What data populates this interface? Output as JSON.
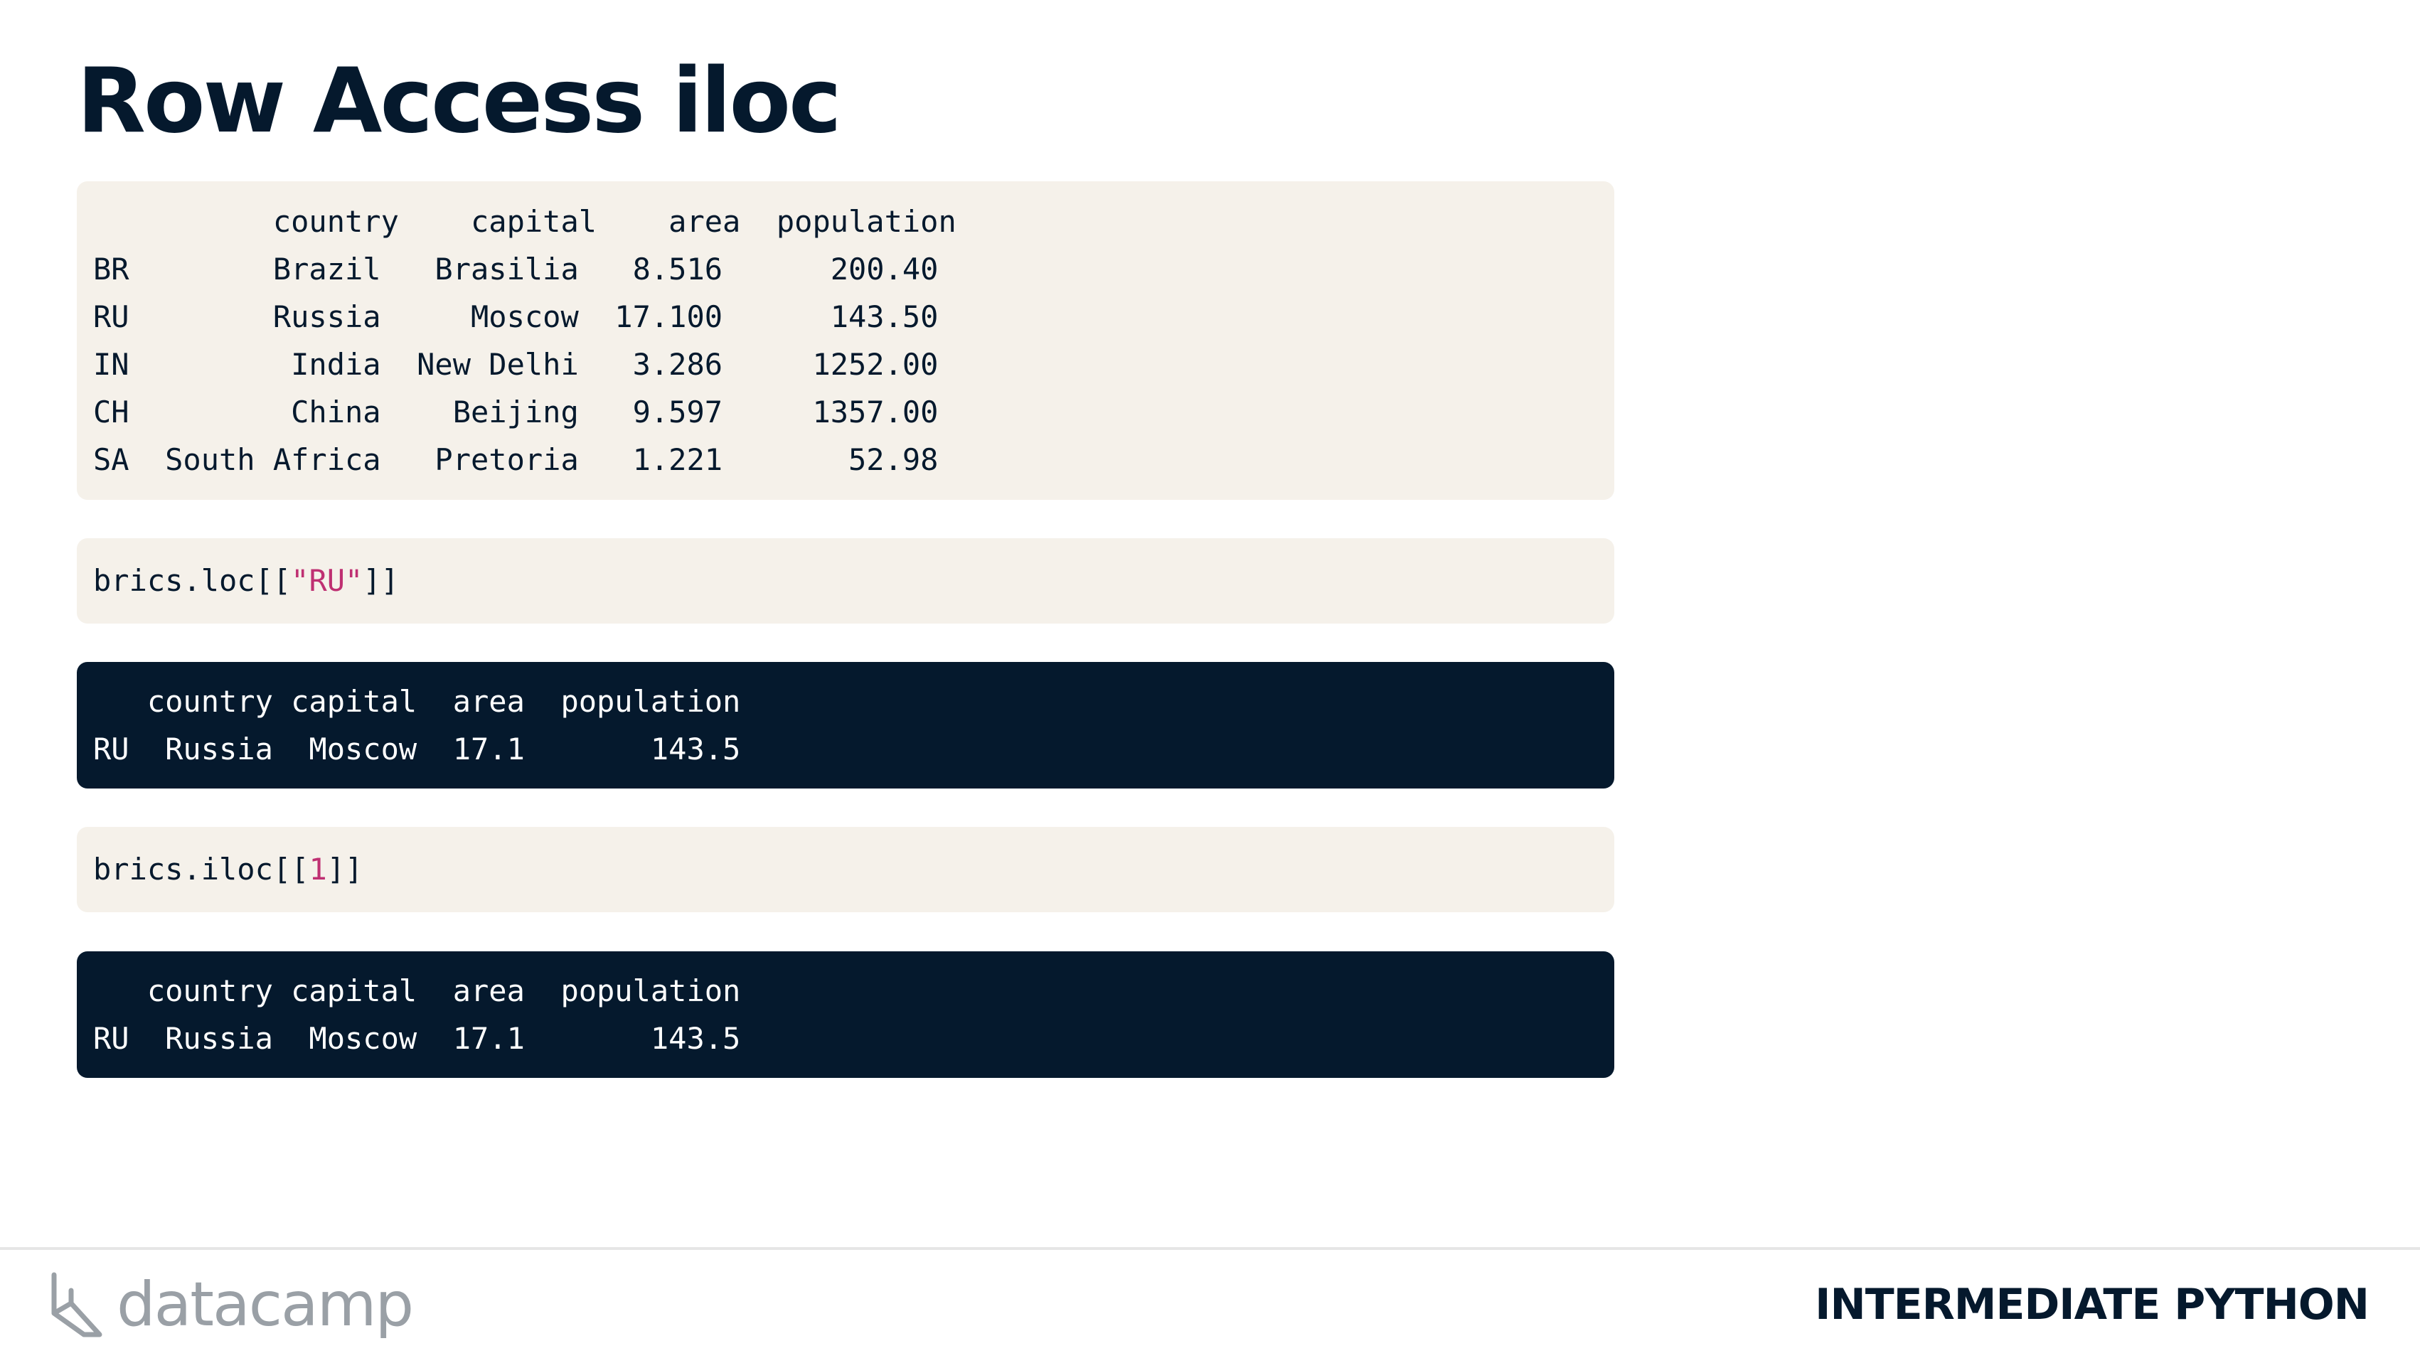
{
  "slide": {
    "title": "Row Access iloc"
  },
  "dataframe_block": {
    "lines": [
      "          country    capital    area  population",
      "BR        Brazil   Brasilia   8.516      200.40",
      "RU        Russia     Moscow  17.100      143.50",
      "IN         India  New Delhi   3.286     1252.00",
      "CH         China    Beijing   9.597     1357.00",
      "SA  South Africa   Pretoria   1.221       52.98"
    ]
  },
  "code_loc": {
    "prefix": "brics.loc[[",
    "arg": "\"RU\"",
    "suffix": "]]"
  },
  "output_loc": {
    "lines": [
      "   country capital  area  population",
      "RU  Russia  Moscow  17.1       143.5"
    ]
  },
  "code_iloc": {
    "prefix": "brics.iloc[[",
    "arg": "1",
    "suffix": "]]"
  },
  "output_iloc": {
    "lines": [
      "   country capital  area  population",
      "RU  Russia  Moscow  17.1       143.5"
    ]
  },
  "footer": {
    "brand": "datacamp",
    "course": "INTERMEDIATE PYTHON",
    "brand_color": "#9aa0a6",
    "title_color": "#05192d"
  },
  "colors": {
    "code_bg_light": "#f5f1ea",
    "code_bg_dark": "#05192d",
    "literal": "#bf3072"
  }
}
